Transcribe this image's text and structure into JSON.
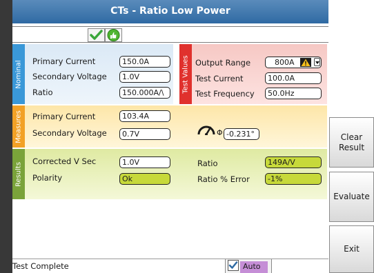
{
  "window": {
    "title": "CTs - Ratio Low Power"
  },
  "status_icons": [
    "check-icon",
    "thumbs-up-icon"
  ],
  "nominal": {
    "tab_label": "Nominal",
    "primary_current": {
      "label": "Primary Current",
      "value": "150.0A"
    },
    "secondary_voltage": {
      "label": "Secondary Voltage",
      "value": "1.0V"
    },
    "ratio": {
      "label": "Ratio",
      "value": "150.000A/\\"
    }
  },
  "test_values": {
    "tab_label": "Test Values",
    "output_range": {
      "label": "Output Range",
      "value": "800A"
    },
    "test_current": {
      "label": "Test Current",
      "value": "100.0A"
    },
    "test_frequency": {
      "label": "Test Frequency",
      "value": "50.0Hz"
    }
  },
  "measures": {
    "tab_label": "Measures",
    "primary_current": {
      "label": "Primary Current",
      "value": "103.4A"
    },
    "secondary_voltage": {
      "label": "Secondary Voltage",
      "value": "0.7V"
    },
    "phase": {
      "symbol": "Φ",
      "value": "-0.231°"
    }
  },
  "results": {
    "tab_label": "Results",
    "corrected_v_sec": {
      "label": "Corrected V Sec",
      "value": "1.0V"
    },
    "polarity": {
      "label": "Polarity",
      "value": "Ok"
    },
    "ratio": {
      "label": "Ratio",
      "value": "149A/V"
    },
    "ratio_error": {
      "label": "Ratio % Error",
      "value": "-1%"
    }
  },
  "buttons": {
    "clear_result_line1": "Clear",
    "clear_result_line2": "Result",
    "evaluate": "Evaluate",
    "exit": "Exit"
  },
  "status_bar": {
    "text": "Test Complete",
    "auto_label": "Auto",
    "auto_checked": true
  },
  "colors": {
    "title_bar": "#2f6aa3",
    "nominal": "#3a98d8",
    "test_values": "#e0312d",
    "measures": "#f2a126",
    "results": "#7aa33a",
    "result_field": "#c7d93a"
  }
}
